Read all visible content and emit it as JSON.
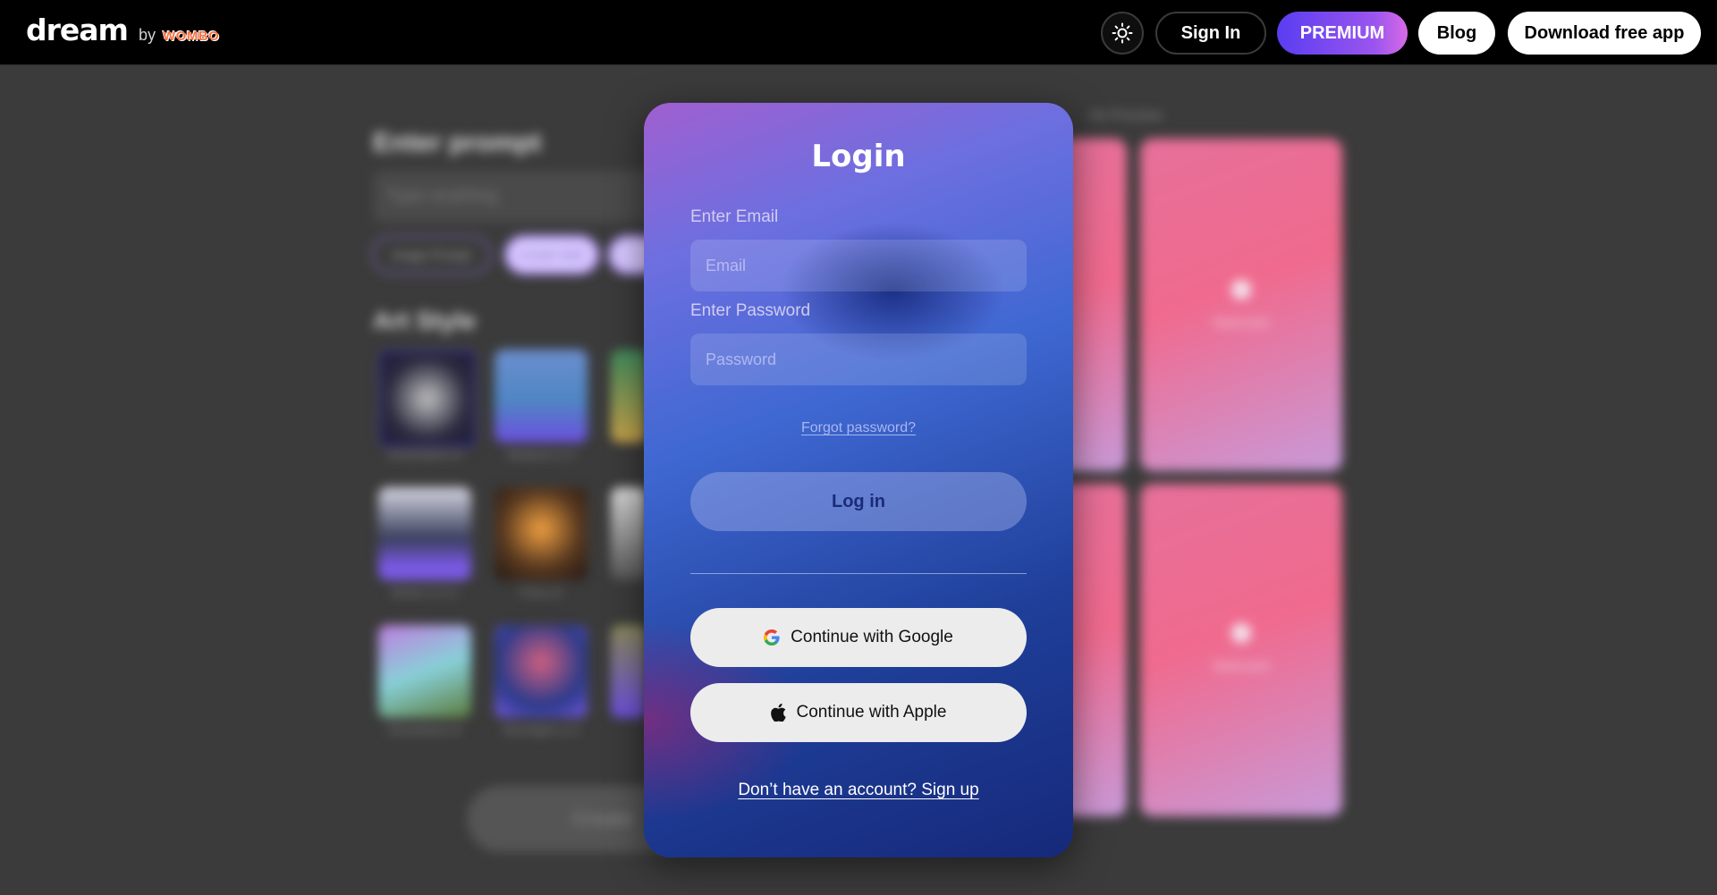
{
  "header": {
    "logo_text": "dream",
    "logo_by": "by",
    "logo_brand": "WOMBO",
    "theme_icon": "sun-icon",
    "sign_in": "Sign In",
    "premium": "PREMIUM",
    "blog": "Blog",
    "download": "Download free app"
  },
  "background": {
    "prompt_title": "Enter prompt",
    "prompt_placeholder": "Type anything",
    "chips": [
      "Image Prompt",
      "Create With",
      ""
    ],
    "art_style_title": "Art Style",
    "styles": [
      {
        "label": "Dreamland v3"
      },
      {
        "label": "Mystical v1.3"
      },
      {
        "label": "Anime v1.3.1"
      },
      {
        "label": "Flora v2"
      },
      {
        "label": "Dreamland v3"
      },
      {
        "label": "Moonlight v1.3"
      }
    ],
    "create_label": "Create",
    "art_preview_title": "Art Preview",
    "card_badge": "Watermark"
  },
  "login": {
    "title": "Login",
    "email_label": "Enter Email",
    "email_placeholder": "Email",
    "password_label": "Enter Password",
    "password_placeholder": "Password",
    "forgot": "Forgot password?",
    "login_button": "Log in",
    "google_button": "Continue with Google",
    "apple_button": "Continue with Apple",
    "signup": "Don’t have an account? Sign up"
  },
  "colors": {
    "premium_gradient_start": "#5a3df0",
    "premium_gradient_end": "#d86ae6",
    "modal_top": "#a05fd0",
    "modal_bottom": "#16297a"
  }
}
